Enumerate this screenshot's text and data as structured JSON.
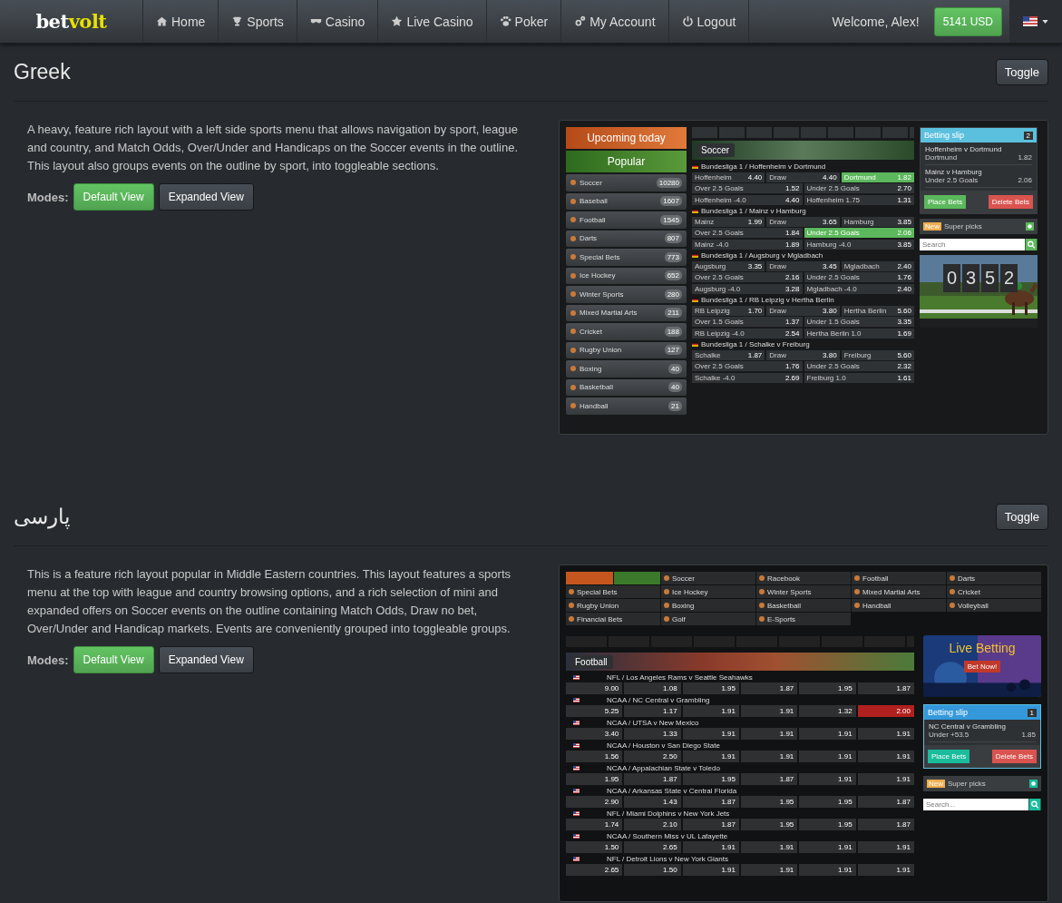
{
  "navbar": {
    "logo": {
      "part1": "bet",
      "part2": "volt"
    },
    "items": [
      {
        "label": "Home"
      },
      {
        "label": "Sports"
      },
      {
        "label": "Casino"
      },
      {
        "label": "Live Casino"
      },
      {
        "label": "Poker"
      },
      {
        "label": "My Account"
      },
      {
        "label": "Logout"
      }
    ],
    "welcome": "Welcome, Alex!",
    "balance": "5141 USD"
  },
  "layouts": [
    {
      "title": "Greek",
      "toggle": "Toggle",
      "description": "A heavy, feature rich layout with a left side sports menu that allows navigation by sport, league and country, and Match Odds, Over/Under and Handicaps on the Soccer events in the outline. This layout also groups events on the outline by sport, into toggleable sections.",
      "modes_label": "Modes:",
      "modes": [
        {
          "label": "Default View",
          "selected": true
        },
        {
          "label": "Expanded View",
          "selected": false
        }
      ],
      "preview": {
        "kind": "sidebar",
        "banners": [
          {
            "label": "Upcoming today",
            "kind": "upcoming"
          },
          {
            "label": "Popular",
            "kind": "popular"
          }
        ],
        "sports": [
          {
            "name": "Soccer",
            "count": "10280"
          },
          {
            "name": "Baseball",
            "count": "1607"
          },
          {
            "name": "Football",
            "count": "1545"
          },
          {
            "name": "Darts",
            "count": "807"
          },
          {
            "name": "Special Bets",
            "count": "773"
          },
          {
            "name": "Ice Hockey",
            "count": "652"
          },
          {
            "name": "Winter Sports",
            "count": "280"
          },
          {
            "name": "Mixed Martial Arts",
            "count": "211"
          },
          {
            "name": "Cricket",
            "count": "188"
          },
          {
            "name": "Rugby Union",
            "count": "127"
          },
          {
            "name": "Boxing",
            "count": "40"
          },
          {
            "name": "Basketball",
            "count": "40"
          },
          {
            "name": "Handball",
            "count": "21"
          }
        ],
        "section": "Soccer",
        "matches": [
          {
            "title": "Bundesliga 1 / Hoffenheim v Dortmund",
            "rows": [
              [
                {
                  "label": "Hoffenheim",
                  "odd": "4.40",
                  "selected": false
                },
                {
                  "label": "Draw",
                  "odd": "4.40",
                  "selected": false
                },
                {
                  "label": "Dortmund",
                  "odd": "1.82",
                  "selected": true
                }
              ],
              [
                {
                  "label": "Over 2.5 Goals",
                  "odd": "1.52",
                  "selected": false
                },
                {
                  "label": "Under 2.5 Goals",
                  "odd": "2.70",
                  "selected": false
                }
              ],
              [
                {
                  "label": "Hoffenheim -4.0",
                  "odd": "4.40",
                  "selected": false
                },
                {
                  "label": "Hoffenheim 1.75",
                  "odd": "1.31",
                  "selected": false
                }
              ]
            ]
          },
          {
            "title": "Bundesliga 1 / Mainz v Hamburg",
            "rows": [
              [
                {
                  "label": "Mainz",
                  "odd": "1.99",
                  "selected": false
                },
                {
                  "label": "Draw",
                  "odd": "3.65",
                  "selected": false
                },
                {
                  "label": "Hamburg",
                  "odd": "3.85",
                  "selected": false
                }
              ],
              [
                {
                  "label": "Over 2.5 Goals",
                  "odd": "1.84",
                  "selected": false
                },
                {
                  "label": "Under 2.5 Goals",
                  "odd": "2.06",
                  "selected": true
                }
              ],
              [
                {
                  "label": "Mainz -4.0",
                  "odd": "1.89",
                  "selected": false
                },
                {
                  "label": "Hamburg -4.0",
                  "odd": "3.85",
                  "selected": false
                }
              ]
            ]
          },
          {
            "title": "Bundesliga 1 / Augsburg v Mgladbach",
            "rows": [
              [
                {
                  "label": "Augsburg",
                  "odd": "3.35",
                  "selected": false
                },
                {
                  "label": "Draw",
                  "odd": "3.45",
                  "selected": false
                },
                {
                  "label": "Mgladbach",
                  "odd": "2.40",
                  "selected": false
                }
              ],
              [
                {
                  "label": "Over 2.5 Goals",
                  "odd": "2.16",
                  "selected": false
                },
                {
                  "label": "Under 2.5 Goals",
                  "odd": "1.76",
                  "selected": false
                }
              ],
              [
                {
                  "label": "Augsburg -4.0",
                  "odd": "3.28",
                  "selected": false
                },
                {
                  "label": "Mgladbach -4.0",
                  "odd": "2.40",
                  "selected": false
                }
              ]
            ]
          },
          {
            "title": "Bundesliga 1 / RB Leipzig v Hertha Berlin",
            "rows": [
              [
                {
                  "label": "RB Leipzig",
                  "odd": "1.70",
                  "selected": false
                },
                {
                  "label": "Draw",
                  "odd": "3.80",
                  "selected": false
                },
                {
                  "label": "Hertha Berlin",
                  "odd": "5.60",
                  "selected": false
                }
              ],
              [
                {
                  "label": "Over 1.5 Goals",
                  "odd": "1.37",
                  "selected": false
                },
                {
                  "label": "Under 1.5 Goals",
                  "odd": "3.35",
                  "selected": false
                }
              ],
              [
                {
                  "label": "RB Leipzig -4.0",
                  "odd": "2.54",
                  "selected": false
                },
                {
                  "label": "Hertha Berlin 1.0",
                  "odd": "1.69",
                  "selected": false
                }
              ]
            ]
          },
          {
            "title": "Bundesliga 1 / Schalke v Freiburg",
            "rows": [
              [
                {
                  "label": "Schalke",
                  "odd": "1.87",
                  "selected": false
                },
                {
                  "label": "Draw",
                  "odd": "3.80",
                  "selected": false
                },
                {
                  "label": "Freiburg",
                  "odd": "5.60",
                  "selected": false
                }
              ],
              [
                {
                  "label": "Over 2.5 Goals",
                  "odd": "1.76",
                  "selected": false
                },
                {
                  "label": "Under 2.5 Goals",
                  "odd": "2.32",
                  "selected": false
                }
              ],
              [
                {
                  "label": "Schalke -4.0",
                  "odd": "2.69",
                  "selected": false
                },
                {
                  "label": "Freiburg 1.0",
                  "odd": "1.61",
                  "selected": false
                }
              ]
            ]
          }
        ],
        "slip": {
          "title": "Betting slip",
          "count": "2",
          "bets": [
            {
              "event": "Hoffenheim v Dortmund",
              "pick": "Dortmund",
              "odd": "1.82"
            },
            {
              "event": "Mainz v Hamburg",
              "pick": "Under 2.5 Goals",
              "odd": "2.06"
            }
          ],
          "place": "Place Bets",
          "delete": "Delete Bets"
        },
        "super_picks": {
          "badge": "New",
          "label": "Super picks"
        },
        "search": {
          "placeholder": "Search"
        },
        "countdown": [
          "0",
          "3",
          "5",
          "2"
        ]
      }
    },
    {
      "title": "پارسی",
      "toggle": "Toggle",
      "description": "This is a feature rich layout popular in Middle Eastern countries. This layout features a sports menu at the top with league and country browsing options, and a rich selection of mini and expanded offers on Soccer events on the outline containing Match Odds, Draw no bet, Over/Under and Handicap markets. Events are conveniently grouped into toggleable groups.",
      "modes_label": "Modes:",
      "modes": [
        {
          "label": "Default View",
          "selected": true
        },
        {
          "label": "Expanded View",
          "selected": false
        }
      ],
      "preview": {
        "kind": "topmenu",
        "sports": [
          {
            "name": "Soccer"
          },
          {
            "name": "Racebook"
          },
          {
            "name": "Football"
          },
          {
            "name": "Darts"
          },
          {
            "name": "Special Bets"
          },
          {
            "name": "Ice Hockey"
          },
          {
            "name": "Winter Sports"
          },
          {
            "name": "Mixed Martial Arts"
          },
          {
            "name": "Cricket"
          },
          {
            "name": "Rugby Union"
          },
          {
            "name": "Boxing"
          },
          {
            "name": "Basketball"
          },
          {
            "name": "Handball"
          },
          {
            "name": "Volleyball"
          },
          {
            "name": "Financial Bets"
          },
          {
            "name": "Golf"
          },
          {
            "name": "E-Sports"
          }
        ],
        "section": "Football",
        "matches": [
          {
            "title": "NFL / Los Angeles Rams v Seattle Seahawks",
            "cells": [
              {
                "odd": "9.00",
                "selected": false
              },
              {
                "odd": "1.08",
                "selected": false
              },
              {
                "odd": "1.95",
                "selected": false
              },
              {
                "odd": "1.87",
                "selected": false
              },
              {
                "odd": "1.95",
                "selected": false
              },
              {
                "odd": "1.87",
                "selected": false
              }
            ]
          },
          {
            "title": "NCAA / NC Central v Grambling",
            "cells": [
              {
                "odd": "5.25",
                "selected": false
              },
              {
                "odd": "1.17",
                "selected": false
              },
              {
                "odd": "1.91",
                "selected": false
              },
              {
                "odd": "1.91",
                "selected": false
              },
              {
                "odd": "1.32",
                "selected": false
              },
              {
                "odd": "2.00",
                "selected": true
              }
            ]
          },
          {
            "title": "NCAA / UTSA v New Mexico",
            "cells": [
              {
                "odd": "3.40",
                "selected": false
              },
              {
                "odd": "1.33",
                "selected": false
              },
              {
                "odd": "1.91",
                "selected": false
              },
              {
                "odd": "1.91",
                "selected": false
              },
              {
                "odd": "1.91",
                "selected": false
              },
              {
                "odd": "1.91",
                "selected": false
              }
            ]
          },
          {
            "title": "NCAA / Houston v San Diego State",
            "cells": [
              {
                "odd": "1.56",
                "selected": false
              },
              {
                "odd": "2.50",
                "selected": false
              },
              {
                "odd": "1.91",
                "selected": false
              },
              {
                "odd": "1.91",
                "selected": false
              },
              {
                "odd": "1.91",
                "selected": false
              },
              {
                "odd": "1.91",
                "selected": false
              }
            ]
          },
          {
            "title": "NCAA / Appalachian State v Toledo",
            "cells": [
              {
                "odd": "1.95",
                "selected": false
              },
              {
                "odd": "1.87",
                "selected": false
              },
              {
                "odd": "1.95",
                "selected": false
              },
              {
                "odd": "1.87",
                "selected": false
              },
              {
                "odd": "1.91",
                "selected": false
              },
              {
                "odd": "1.91",
                "selected": false
              }
            ]
          },
          {
            "title": "NCAA / Arkansas State v Central Florida",
            "cells": [
              {
                "odd": "2.90",
                "selected": false
              },
              {
                "odd": "1.43",
                "selected": false
              },
              {
                "odd": "1.87",
                "selected": false
              },
              {
                "odd": "1.95",
                "selected": false
              },
              {
                "odd": "1.95",
                "selected": false
              },
              {
                "odd": "1.87",
                "selected": false
              }
            ]
          },
          {
            "title": "NFL / Miami Dolphins v New York Jets",
            "cells": [
              {
                "odd": "1.74",
                "selected": false
              },
              {
                "odd": "2.10",
                "selected": false
              },
              {
                "odd": "1.87",
                "selected": false
              },
              {
                "odd": "1.95",
                "selected": false
              },
              {
                "odd": "1.95",
                "selected": false
              },
              {
                "odd": "1.87",
                "selected": false
              }
            ]
          },
          {
            "title": "NCAA / Southern Miss v UL Lafayette",
            "cells": [
              {
                "odd": "1.50",
                "selected": false
              },
              {
                "odd": "2.65",
                "selected": false
              },
              {
                "odd": "1.91",
                "selected": false
              },
              {
                "odd": "1.91",
                "selected": false
              },
              {
                "odd": "1.91",
                "selected": false
              },
              {
                "odd": "1.91",
                "selected": false
              }
            ]
          },
          {
            "title": "NFL / Detroit Lions v New York Giants",
            "cells": [
              {
                "odd": "2.65",
                "selected": false
              },
              {
                "odd": "1.50",
                "selected": false
              },
              {
                "odd": "1.91",
                "selected": false
              },
              {
                "odd": "1.91",
                "selected": false
              },
              {
                "odd": "1.91",
                "selected": false
              },
              {
                "odd": "1.91",
                "selected": false
              }
            ]
          }
        ],
        "live": {
          "title": "Live Betting",
          "button": "Bet Now!"
        },
        "slip": {
          "title": "Betting slip",
          "count": "1",
          "bets": [
            {
              "event": "NC Central v Grambling",
              "pick": "Under +53.5",
              "odd": "1.85"
            }
          ],
          "place": "Place Bets",
          "delete": "Delete Bets"
        },
        "super_picks": {
          "badge": "New",
          "label": "Super picks"
        },
        "search": {
          "placeholder": "Search..."
        }
      }
    }
  ]
}
